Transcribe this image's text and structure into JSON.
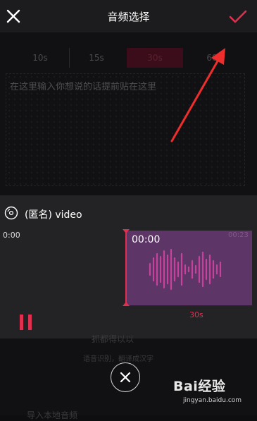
{
  "header": {
    "title": "音频选择",
    "close_icon": "close-icon",
    "confirm_icon": "check-icon",
    "confirm_color": "#e1304f"
  },
  "durations": {
    "options": [
      "10s",
      "15s",
      "30s",
      "60"
    ],
    "selected": "30s"
  },
  "prompt": {
    "placeholder": "在这里输入你想说的话提前贴在这里"
  },
  "audio_panel": {
    "track_icon": "disc-icon",
    "track_name": "(匿名) video",
    "start_time": "0:00",
    "end_time": "00:23",
    "selection_time": "00:00",
    "selection_duration": "30s",
    "accent_color": "#e1304f",
    "selection_color": "#5d3567",
    "pause_icon": "pause-icon"
  },
  "background_hints": {
    "title": "抓都得以以",
    "subtitle": "语音识别，翻译成汉字",
    "import_label": "导入本地音频"
  },
  "watermark": {
    "logo": "Bai经验",
    "url": "jingyan.baidu.com"
  }
}
